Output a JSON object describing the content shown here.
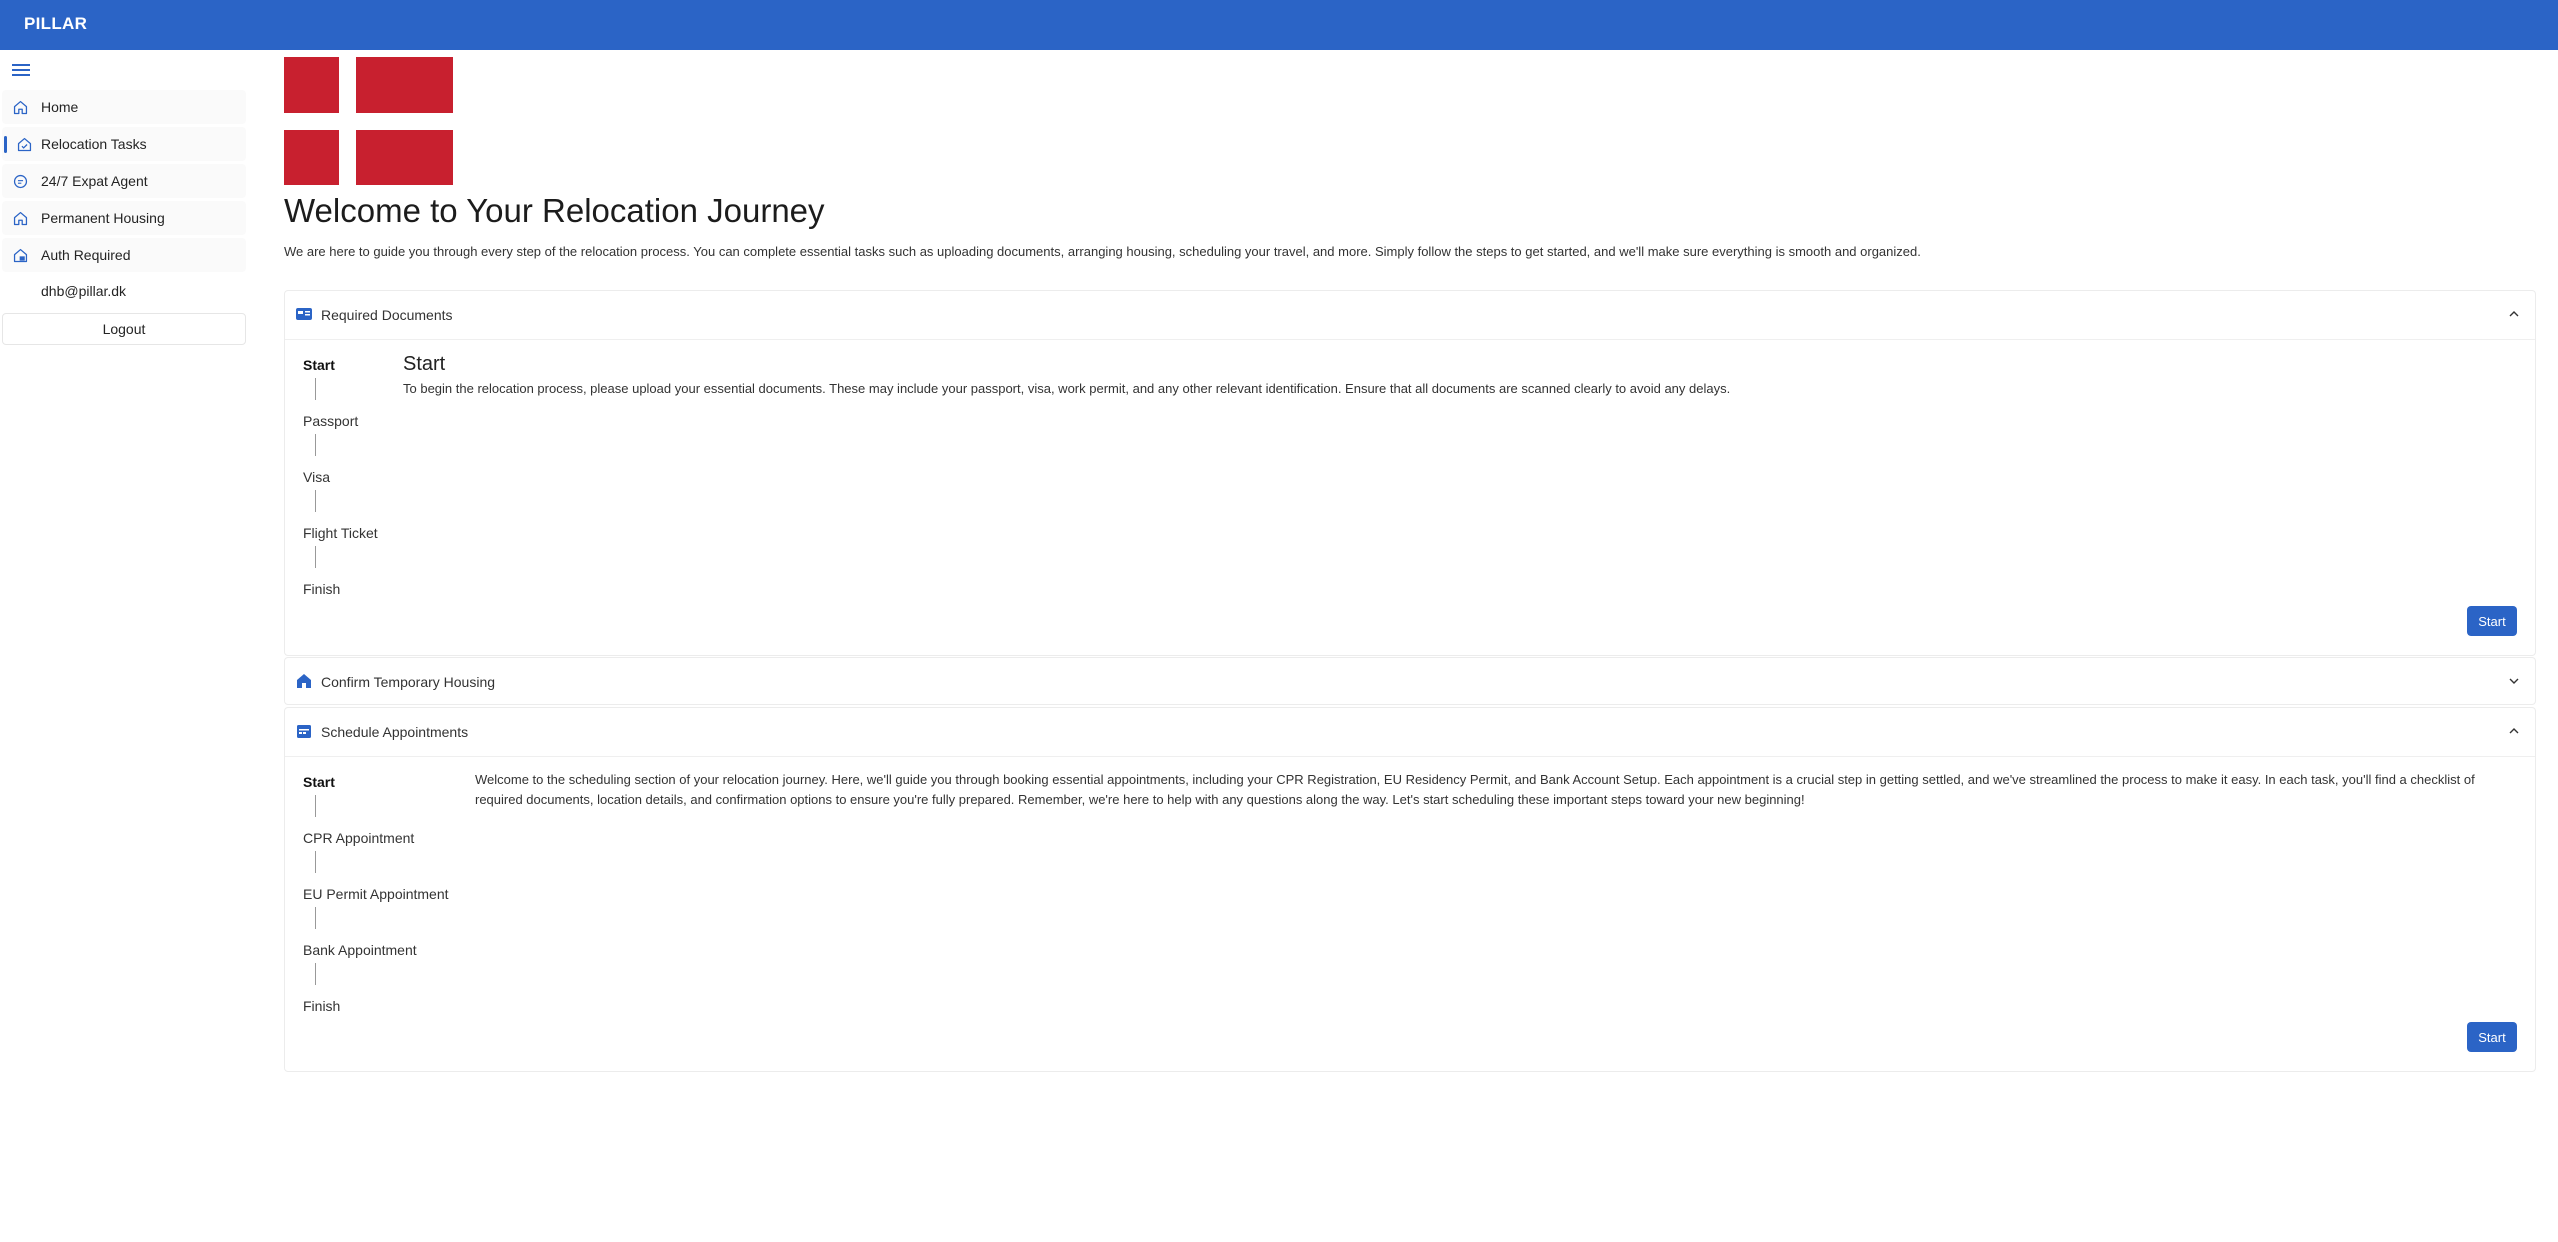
{
  "app": {
    "brand": "PILLAR"
  },
  "sidebar": {
    "items": [
      {
        "label": "Home",
        "icon": "home-icon"
      },
      {
        "label": "Relocation Tasks",
        "icon": "tasks-icon"
      },
      {
        "label": "24/7 Expat Agent",
        "icon": "chat-icon"
      },
      {
        "label": "Permanent Housing",
        "icon": "home-icon"
      },
      {
        "label": "Auth Required",
        "icon": "lock-icon"
      }
    ],
    "user_email": "dhb@pillar.dk",
    "logout_label": "Logout"
  },
  "main": {
    "title": "Welcome to Your Relocation Journey",
    "intro": "We are here to guide you through every step of the relocation process. You can complete essential tasks such as uploading documents, arranging housing, scheduling your travel, and more. Simply follow the steps to get started, and we'll make sure everything is smooth and organized."
  },
  "sections": {
    "documents": {
      "title": "Required Documents",
      "steps": [
        "Start",
        "Passport",
        "Visa",
        "Flight Ticket",
        "Finish"
      ],
      "content_title": "Start",
      "content_text": "To begin the relocation process, please upload your essential documents. These may include your passport, visa, work permit, and any other relevant identification. Ensure that all documents are scanned clearly to avoid any delays.",
      "button_label": "Start"
    },
    "housing": {
      "title": "Confirm Temporary Housing"
    },
    "appointments": {
      "title": "Schedule Appointments",
      "steps": [
        "Start",
        "CPR Appointment",
        "EU Permit Appointment",
        "Bank Appointment",
        "Finish"
      ],
      "content_text": "Welcome to the scheduling section of your relocation journey. Here, we'll guide you through booking essential appointments, including your CPR Registration, EU Residency Permit, and Bank Account Setup. Each appointment is a crucial step in getting settled, and we've streamlined the process to make it easy. In each task, you'll find a checklist of required documents, location details, and confirmation options to ensure you're fully prepared. Remember, we're here to help with any questions along the way. Let's start scheduling these important steps toward your new beginning!",
      "button_label": "Start"
    }
  },
  "colors": {
    "brand": "#2b64c6",
    "flag_red": "#c8202f"
  }
}
